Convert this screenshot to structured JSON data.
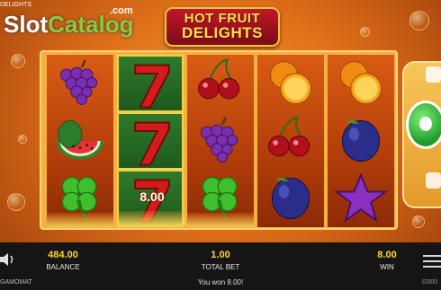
{
  "watermark": {
    "slot": "Slot",
    "catalog": "Catalog",
    "com": ".com"
  },
  "game_title_small": "DELIGHTS",
  "logo": {
    "line1": "HOT FRUIT",
    "line2": "DELIGHTS"
  },
  "reels": [
    [
      "grape",
      "watermelon",
      "clover"
    ],
    [
      "seven",
      "seven",
      "seven"
    ],
    [
      "cherry",
      "grape",
      "clover"
    ],
    [
      "orange",
      "cherry",
      "plum"
    ],
    [
      "orange",
      "plum",
      "star"
    ]
  ],
  "win_overlay": "8.00",
  "status_bar": {
    "balance_value": "484.00",
    "balance_label": "BALANCE",
    "bet_value": "1.00",
    "bet_label": "TOTAL BET",
    "win_value": "8.00",
    "win_label": "WIN"
  },
  "message": "You won  8.00!",
  "brand": "GAMOMAT",
  "version": "G000",
  "colors": {
    "accent": "#ffd52e",
    "spin": "#1f9b2b",
    "reel_bg": "#d95c14"
  }
}
